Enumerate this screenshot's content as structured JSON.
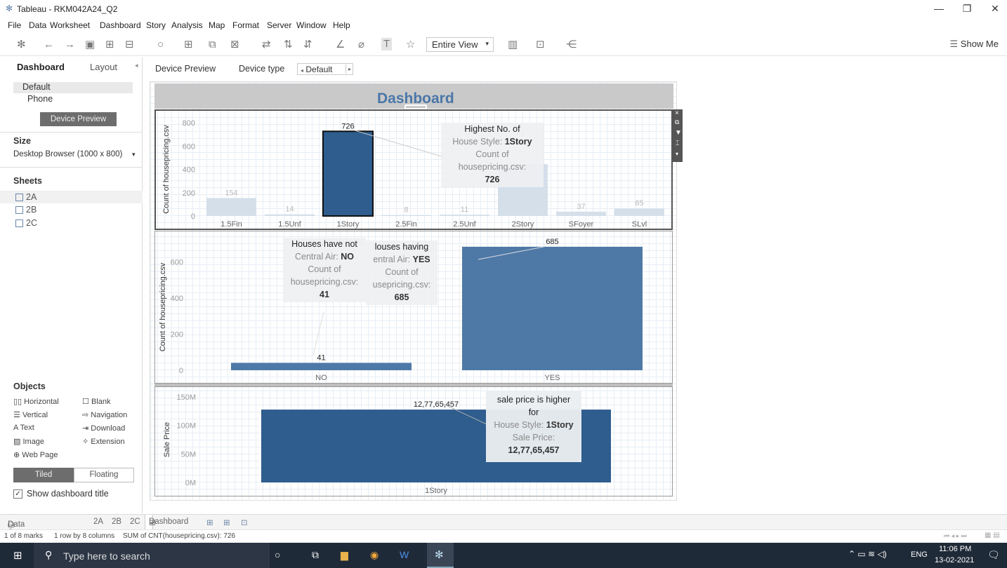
{
  "window": {
    "title": "Tableau - RKM042A24_Q2",
    "minimize": "—",
    "maximize": "❐",
    "close": "✕"
  },
  "menu": [
    "File",
    "Data",
    "Worksheet",
    "Dashboard",
    "Story",
    "Analysis",
    "Map",
    "Format",
    "Server",
    "Window",
    "Help"
  ],
  "toolbar": {
    "fit_label": "Entire View",
    "show_me": "Show Me"
  },
  "left_pane": {
    "tabs": [
      "Dashboard",
      "Layout"
    ],
    "devices": [
      "Default",
      "Phone"
    ],
    "device_preview_button": "Device Preview",
    "size_heading": "Size",
    "size_value": "Desktop Browser (1000 x 800)",
    "sheets_heading": "Sheets",
    "sheets": [
      "2A",
      "2B",
      "2C"
    ],
    "objects_heading": "Objects",
    "objects": [
      "Horizontal",
      "Blank",
      "Vertical",
      "Navigation",
      "Text",
      "Download",
      "Image",
      "Extension",
      "Web Page"
    ],
    "tiled": "Tiled",
    "floating": "Floating",
    "show_title": "Show dashboard title"
  },
  "canvas_bar": {
    "device_preview": "Device Preview",
    "device_type_label": "Device type",
    "device_type_value": "Default"
  },
  "dashboard_title": "Dashboard",
  "chart_data": [
    {
      "type": "bar",
      "ylabel": "Count of housepricing.csv",
      "categories": [
        "1.5Fin",
        "1.5Unf",
        "1Story",
        "2.5Fin",
        "2.5Unf",
        "2Story",
        "SFoyer",
        "SLvl"
      ],
      "values": [
        154,
        14,
        726,
        8,
        11,
        445,
        37,
        65
      ],
      "ylim": [
        0,
        800
      ],
      "yticks": [
        "800",
        "600",
        "400",
        "200",
        "0"
      ],
      "data_labels": [
        "154",
        "14",
        "726",
        "8",
        "11",
        "",
        "37",
        "65"
      ],
      "highlight": "1Story",
      "annotation": {
        "l1": "Highest No. of",
        "l2a": "House Style: ",
        "l2b": "1Story",
        "l3": "Count of",
        "l4": "housepricing.csv:",
        "l5": "726"
      }
    },
    {
      "type": "bar",
      "ylabel": "Count of housepricing.csv",
      "categories": [
        "NO",
        "YES"
      ],
      "values": [
        41,
        685
      ],
      "ylim": [
        0,
        700
      ],
      "yticks": [
        "600",
        "400",
        "200",
        "0"
      ],
      "data_labels": [
        "41",
        "685"
      ],
      "annotation_no": {
        "l1": "Houses have not",
        "l2a": "Central Air: ",
        "l2b": "NO",
        "l3": "Count of",
        "l4": "housepricing.csv:",
        "l5": "41"
      },
      "annotation_yes": {
        "l1": "louses having",
        "l2a": "entral Air: ",
        "l2b": "YES",
        "l3": "Count of",
        "l4": "usepricing.csv:",
        "l5": "685"
      }
    },
    {
      "type": "bar",
      "ylabel": "Sale Price",
      "categories": [
        "1Story"
      ],
      "values": [
        127765457
      ],
      "ylim": [
        0,
        150000000
      ],
      "yticks": [
        "150M",
        "100M",
        "50M",
        "0M"
      ],
      "data_labels": [
        "12,77,65,457"
      ],
      "annotation": {
        "l1": "sale price is higher",
        "l1b": "for",
        "l2a": "House Style: ",
        "l2b": "1Story",
        "l3": "Sale Price:",
        "l4": "12,77,65,457"
      }
    }
  ],
  "bottom_tabs": {
    "data_source": "Data Source",
    "sheets": [
      "2A",
      "2B",
      "2C"
    ],
    "dashboard": "Dashboard"
  },
  "status": {
    "marks": "1 of 8 marks",
    "rows": "1 row by 8 columns",
    "sum": "SUM of CNT(housepricing.csv): 726"
  },
  "taskbar": {
    "search": "Type here to search",
    "lang": "ENG",
    "time": "11:06 PM",
    "date": "13-02-2021"
  },
  "colors": {
    "bar": "#2e5d8e",
    "bar_dim": "#d4dfea",
    "bar_mid": "#4e79a7",
    "title_blue": "#4a77a8",
    "taskbar": "#1f2a38"
  }
}
